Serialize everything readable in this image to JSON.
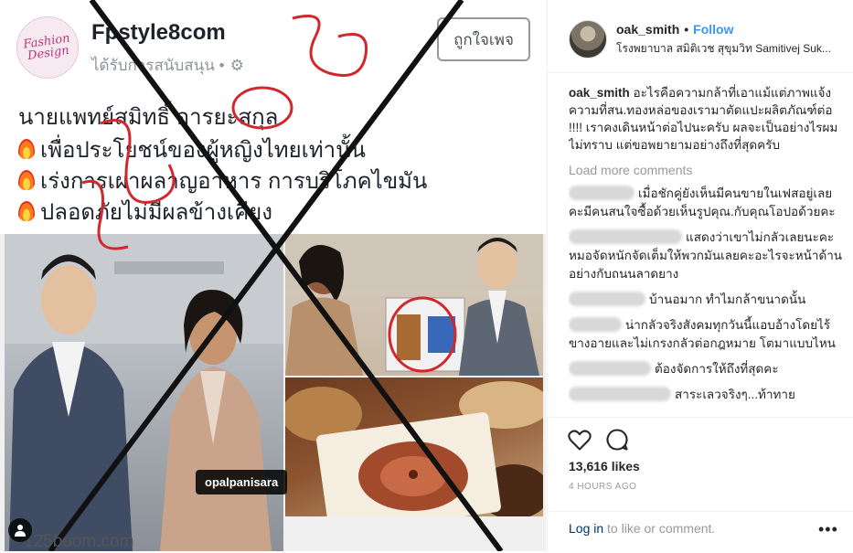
{
  "fb_post": {
    "logo_text": "Fashion Design",
    "page_name": "Fpstyle8com",
    "sponsored": "ได้รับการสนับสนุน •",
    "like_button": "ถูกใจเพจ",
    "lines": [
      "นายแพทย์สมิทธิ์ อารยะสกุล",
      "เพื่อประโยชน์ของผู้หญิงไทยเท่านั้น",
      "เร่งการเผาผลาญอาหาร การบริโภคไขมัน",
      "ปลอดภัยไม่มีผลข้างเคียง"
    ],
    "watermark": "125boom.com",
    "photo_tag": "opalpanisara"
  },
  "post": {
    "username": "oak_smith",
    "follow": "Follow",
    "location": "โรงพยาบาล สมิติเวช สุขุมวิท Samitivej Suk...",
    "caption_user": "oak_smith",
    "caption": "อะไรคือความกล้าที่เอาแม้แต่ภาพแจ้งความที่สน.ทองหล่อของเรามาตัดแปะผลิตภัณฑ์ต่อ !!!! เราคงเดินหน้าต่อไปนะครับ ผลจะเป็นอย่างไรผมไม่ทราบ แต่ขอพยายามอย่างถึงที่สุดครับ",
    "load_more": "Load more comments",
    "comments": [
      "เมื่อชักคู่ยังเห็นมีคนขายในเฟสอยู่เลยคะมีคนสนใจซื้อด้วยเห็นรูปคุณ.กับคุณโอปอด้วยคะ",
      "แสดงว่าเขาไม่กลัวเลยนะคะหมอจัดหนักจัดเต็มให้พวกมันเลยคะอะไรจะหน้าด้านอย่างกับถนนลาดยาง",
      "บ้านอมาก ทำไมกล้าขนาดนั้น",
      "น่ากลัวจริงสังคมทุกวันนี้แอบอ้างโดยไร้ขางอายและไม่เกรงกลัวต่อกฎหมาย โตมาแบบไหน",
      "ต้องจัดการให้ถึงที่สุดคะ",
      "สาระเลวจริงๆ...ท้าทาย"
    ],
    "likes": "13,616 likes",
    "time_ago": "4 HOURS AGO",
    "login_link": "Log in",
    "login_text": " to like or comment.",
    "more": "•••"
  }
}
